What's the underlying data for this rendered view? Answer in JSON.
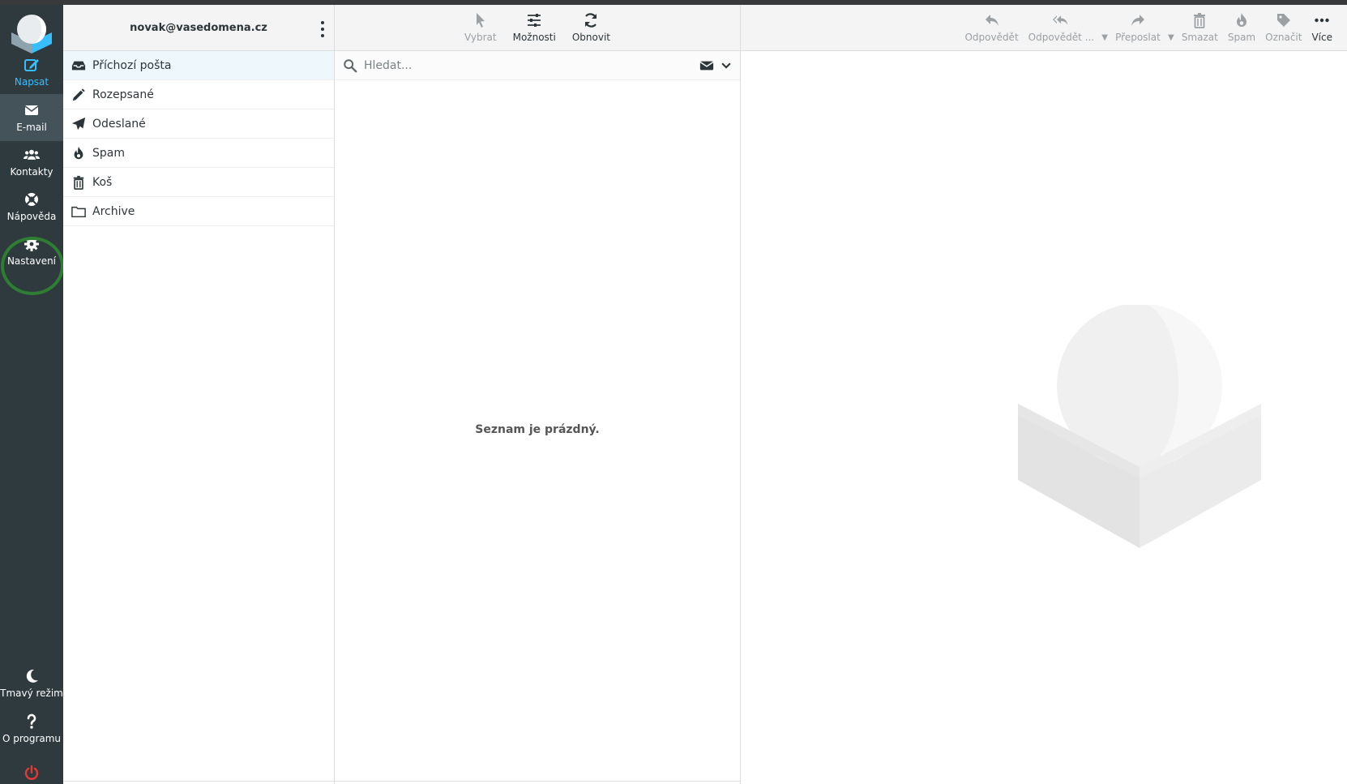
{
  "account": {
    "email": "novak@vasedomena.cz"
  },
  "nav": {
    "items": [
      {
        "label": "Napsat",
        "icon": "compose-icon"
      },
      {
        "label": "E-mail",
        "icon": "envelope-icon"
      },
      {
        "label": "Kontakty",
        "icon": "users-icon"
      },
      {
        "label": "Nápověda",
        "icon": "lifebuoy-icon"
      },
      {
        "label": "Nastavení",
        "icon": "gear-icon"
      }
    ],
    "bottom": [
      {
        "label": "Tmavý režim",
        "icon": "moon-icon"
      },
      {
        "label": "O programu",
        "icon": "question-icon"
      },
      {
        "label": "",
        "icon": "power-icon"
      }
    ]
  },
  "folders": [
    {
      "label": "Příchozí pošta",
      "icon": "inbox-icon",
      "selected": true
    },
    {
      "label": "Rozepsané",
      "icon": "pencil-icon"
    },
    {
      "label": "Odeslané",
      "icon": "paper-plane-icon"
    },
    {
      "label": "Spam",
      "icon": "fire-icon"
    },
    {
      "label": "Koš",
      "icon": "trash-icon"
    },
    {
      "label": "Archive",
      "icon": "folder-icon"
    }
  ],
  "list_toolbar": {
    "select": "Vybrat",
    "options": "Možnosti",
    "refresh": "Obnovit"
  },
  "search": {
    "placeholder": "Hledat..."
  },
  "list": {
    "empty_message": "Seznam je prázdný."
  },
  "message_toolbar": {
    "reply": "Odpovědět",
    "reply_all": "Odpovědět ...",
    "forward": "Přeposlat",
    "delete": "Smazat",
    "spam": "Spam",
    "mark": "Označit",
    "more": "Více"
  },
  "colors": {
    "nav_bg": "#2f3a3f",
    "nav_active_bg": "#44535a",
    "accent": "#37beff",
    "highlight_ring": "#2e7d32",
    "logout": "#e53935",
    "selected_folder_bg": "#eef7fc"
  }
}
